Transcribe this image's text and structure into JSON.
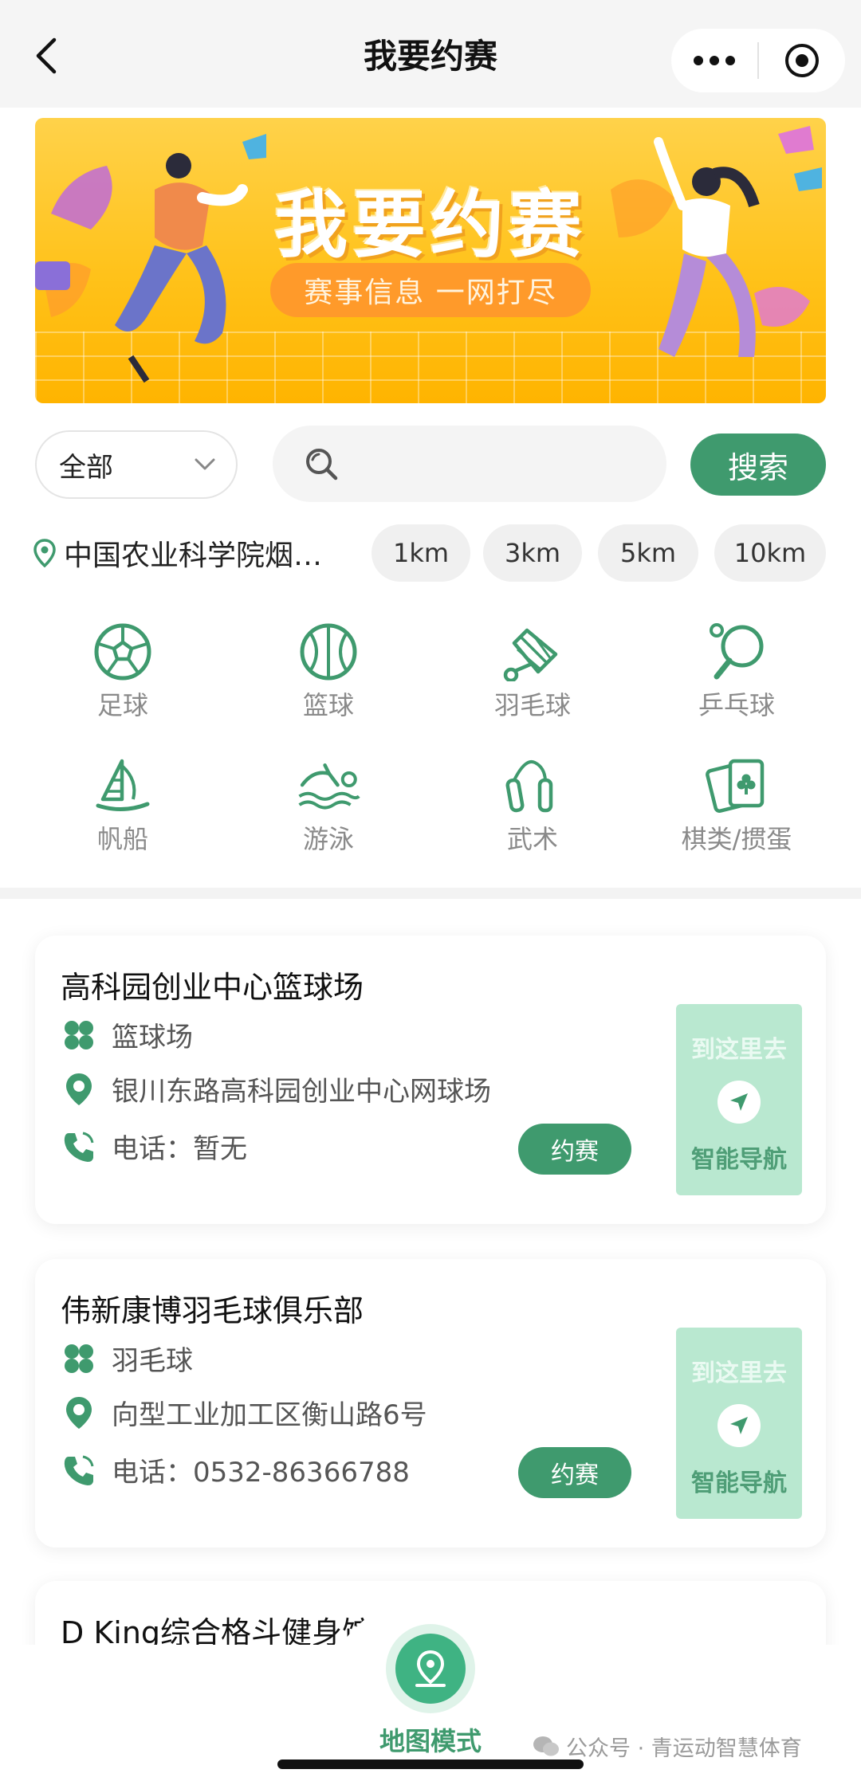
{
  "header": {
    "title": "我要约赛"
  },
  "banner": {
    "title": "我要约赛",
    "subtitle": "赛事信息 一网打尽"
  },
  "filter": {
    "selected": "全部"
  },
  "search": {
    "placeholder": "",
    "button_label": "搜索"
  },
  "location": {
    "text": "中国农业科学院烟…"
  },
  "distances": [
    "1km",
    "3km",
    "5km",
    "10km"
  ],
  "categories": [
    {
      "label": "足球",
      "icon": "soccer-ball-icon"
    },
    {
      "label": "篮球",
      "icon": "basketball-icon"
    },
    {
      "label": "羽毛球",
      "icon": "shuttlecock-icon"
    },
    {
      "label": "乒乓球",
      "icon": "ping-pong-icon"
    },
    {
      "label": "帆船",
      "icon": "sailboat-icon"
    },
    {
      "label": "游泳",
      "icon": "swimmer-icon"
    },
    {
      "label": "武术",
      "icon": "nunchaku-icon"
    },
    {
      "label": "棋类/掼蛋",
      "icon": "playing-cards-icon"
    }
  ],
  "venues": [
    {
      "name": "高科园创业中心篮球场",
      "type": "篮球场",
      "address": "银川东路高科园创业中心网球场",
      "phone": "电话：暂无",
      "book_label": "约赛",
      "nav_top": "到这里去",
      "nav_bottom": "智能导航"
    },
    {
      "name": "伟新康博羽毛球俱乐部",
      "type": "羽毛球",
      "address": "向型工业加工区衡山路6号",
      "phone": "电话：0532-86366788",
      "book_label": "约赛",
      "nav_top": "到这里去",
      "nav_bottom": "智能导航"
    },
    {
      "name": "D King综合格斗健身馆"
    }
  ],
  "bottom": {
    "map_mode_label": "地图模式",
    "watermark": "公众号 · 青运动智慧体育"
  },
  "colors": {
    "accent": "#3f9a6e",
    "nav_card": "#b9e8d0",
    "banner": "#ffc21a"
  }
}
